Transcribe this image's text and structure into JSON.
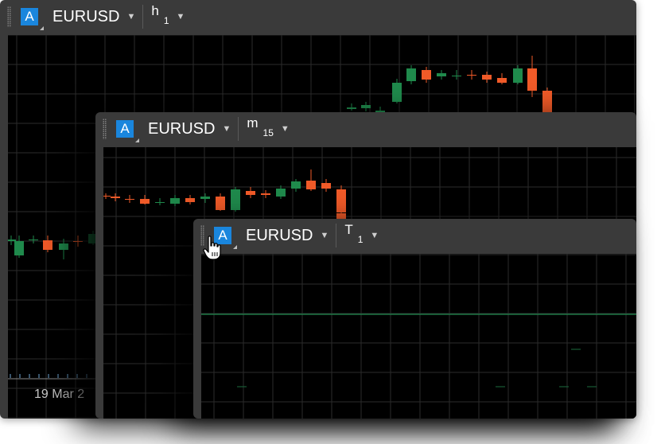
{
  "windows": [
    {
      "account_letter": "A",
      "symbol": "EURUSD",
      "timeframe": "h",
      "timeframe_value": "1"
    },
    {
      "account_letter": "A",
      "symbol": "EURUSD",
      "timeframe": "m",
      "timeframe_value": "15"
    },
    {
      "account_letter": "A",
      "symbol": "EURUSD",
      "timeframe": "T",
      "timeframe_value": "1"
    }
  ],
  "hourly_chart": {
    "date_label": "19 Mar 2"
  },
  "colors": {
    "window_chrome": "#3a3a3a",
    "chart_background": "#000000",
    "grid": "#2b2b2b",
    "bull_candle": "#1f8a4c",
    "bear_candle": "#f05a28",
    "account_badge": "#1a86dd",
    "tick_line": "#1f8a4c"
  },
  "icons": [
    "drag-grip-icon",
    "dropdown-caret-icon",
    "hand-pointer-cursor-icon"
  ]
}
